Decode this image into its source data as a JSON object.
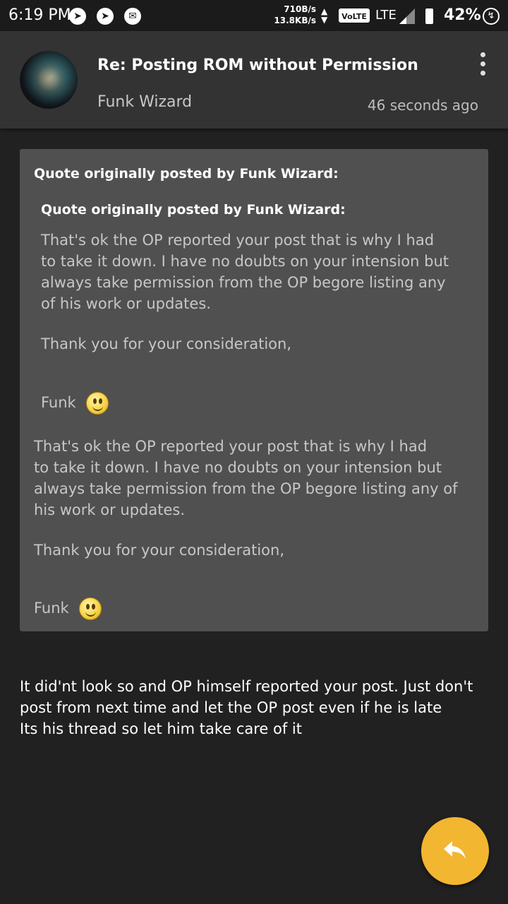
{
  "status_bar": {
    "time": "6:19 PM",
    "notification_icons": [
      "telegram-icon",
      "telegram-icon",
      "mail-icon"
    ],
    "net_speed_down": "710B/s",
    "net_speed_up": "13.8KB/s",
    "volte": "VoLTE",
    "network": "LTE",
    "battery": "42%"
  },
  "header": {
    "title": "Re: Posting ROM without Permission",
    "author": "Funk Wizard",
    "timestamp": "46 seconds ago"
  },
  "quote": {
    "outer_heading": "Quote originally posted by Funk Wizard:",
    "inner_heading": "Quote originally posted by Funk Wizard:",
    "inner_body": "That's ok the OP reported your post that is why I had\nto take it down. I have no doubts on your intension but\nalways take permission from the OP begore listing any\nof his work or updates.",
    "inner_thanks": "Thank you for your consideration,",
    "inner_sign": "Funk",
    "outer_body": "That's ok the OP reported your post that is why I had\nto take it down. I have no doubts on your intension but\nalways take permission from the OP begore listing any of\nhis work or updates.",
    "outer_thanks": "Thank you for your consideration,",
    "outer_sign": "Funk"
  },
  "reply": {
    "body": "It did'nt look so and OP himself reported your post. Just don't\npost from next time and let the OP post even if he is late\nIts his thread so let him take care of it"
  },
  "fab": {
    "icon": "reply-icon",
    "color": "#f2b630"
  },
  "colors": {
    "background": "#212121",
    "header": "#333333",
    "quote_box": "#505050"
  }
}
